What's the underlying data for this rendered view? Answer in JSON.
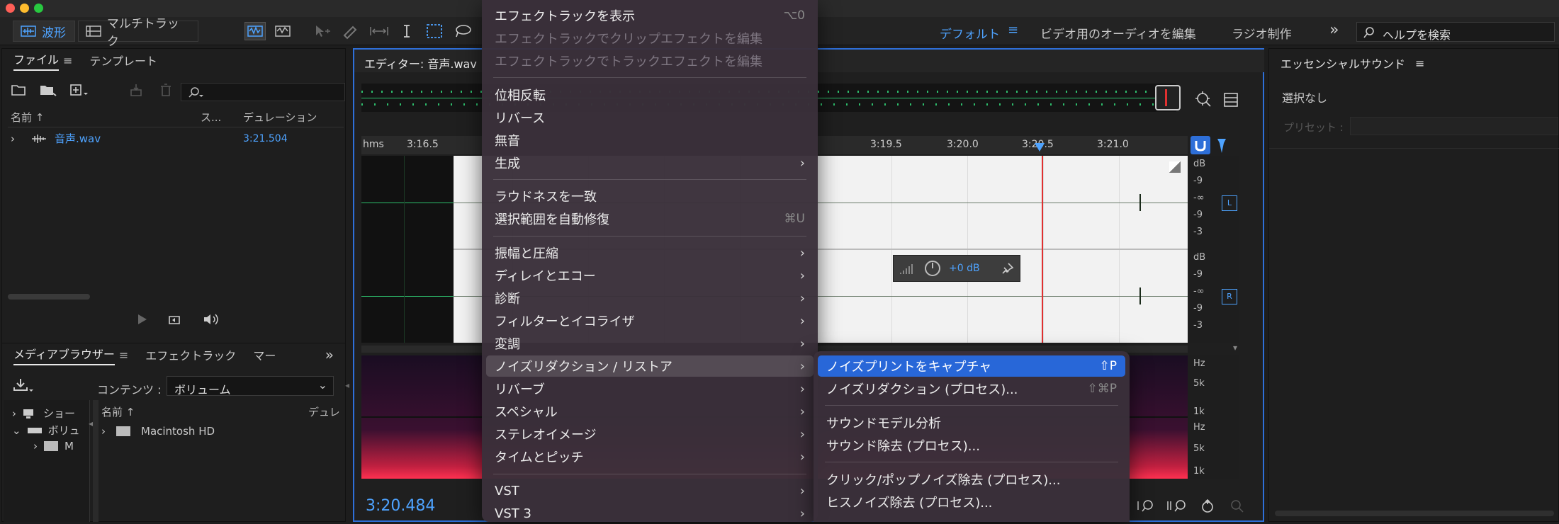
{
  "toolbar": {
    "waveform_label": "波形",
    "multitrack_label": "マルチトラック",
    "workspace_default": "デフォルト",
    "workspace_video_audio": "ビデオ用のオーディオを編集",
    "workspace_radio": "ラジオ制作",
    "search_placeholder": "ヘルプを検索"
  },
  "files_panel": {
    "tab_files": "ファイル",
    "tab_templates": "テンプレート",
    "col_name": "名前 ↑",
    "col_status": "ス...",
    "col_duration": "デュレーション",
    "file_name": "音声.wav",
    "file_duration": "3:21.504"
  },
  "media_panel": {
    "tab_media": "メディアブラウザー",
    "tab_effects": "エフェクトラック",
    "tab_marker": "マー",
    "content_label": "コンテンツ :",
    "content_value": "ボリューム",
    "col_name": "名前 ↑",
    "col_duration": "デュレ",
    "tree_show": "ショー",
    "tree_volume": "ボリュ",
    "tree_m": "M",
    "drive_name": "Macintosh HD"
  },
  "editor": {
    "tab_title": "エディター: 音声.wav",
    "ruler_unit": "hms",
    "ruler_labels": [
      "3:16.5",
      "3:19.5",
      "3:20.0",
      "3:20.5",
      "3:21.0"
    ],
    "time_display": "3:20.484",
    "hud_gain": "+0 dB",
    "db_label": "dB",
    "db_ticks": [
      "-9",
      "-∞",
      "-9",
      "-3"
    ],
    "channel_left": "L",
    "channel_right": "R",
    "hz_label": "Hz",
    "hz_5k": "5k",
    "hz_1k": "1k"
  },
  "essential_sound": {
    "title": "エッセンシャルサウンド",
    "none_selected": "選択なし",
    "preset_label": "プリセット :"
  },
  "menu": {
    "items": [
      {
        "label": "エフェクトラックを表示",
        "shortcut": "⌥0"
      },
      {
        "label": "エフェクトラックでクリップエフェクトを編集"
      },
      {
        "label": "エフェクトラックでトラックエフェクトを編集"
      },
      {
        "label": "位相反転"
      },
      {
        "label": "リバース"
      },
      {
        "label": "無音"
      },
      {
        "label": "生成",
        "arrow": "›"
      },
      {
        "label": "ラウドネスを一致"
      },
      {
        "label": "選択範囲を自動修復",
        "shortcut": "⌘U"
      },
      {
        "label": "振幅と圧縮",
        "arrow": "›"
      },
      {
        "label": "ディレイとエコー",
        "arrow": "›"
      },
      {
        "label": "診断",
        "arrow": "›"
      },
      {
        "label": "フィルターとイコライザ",
        "arrow": "›"
      },
      {
        "label": "変調",
        "arrow": "›"
      },
      {
        "label": "ノイズリダクション / リストア",
        "arrow": "›"
      },
      {
        "label": "リバーブ",
        "arrow": "›"
      },
      {
        "label": "スペシャル",
        "arrow": "›"
      },
      {
        "label": "ステレオイメージ",
        "arrow": "›"
      },
      {
        "label": "タイムとピッチ",
        "arrow": "›"
      },
      {
        "label": "VST",
        "arrow": "›"
      },
      {
        "label": "VST 3",
        "arrow": "›"
      }
    ]
  },
  "submenu": {
    "items": [
      {
        "label": "ノイズプリントをキャプチャ",
        "shortcut": "⇧P"
      },
      {
        "label": "ノイズリダクション (プロセス)...",
        "shortcut": "⇧⌘P"
      },
      {
        "label": "サウンドモデル分析"
      },
      {
        "label": "サウンド除去 (プロセス)..."
      },
      {
        "label": "クリック/ポップノイズ除去 (プロセス)..."
      },
      {
        "label": "ヒスノイズ除去 (プロセス)..."
      }
    ]
  },
  "colors": {
    "accent": "#4ea3ff",
    "highlight": "#2867d8",
    "playhead": "#e03030",
    "waveform": "#2dbe6c"
  }
}
